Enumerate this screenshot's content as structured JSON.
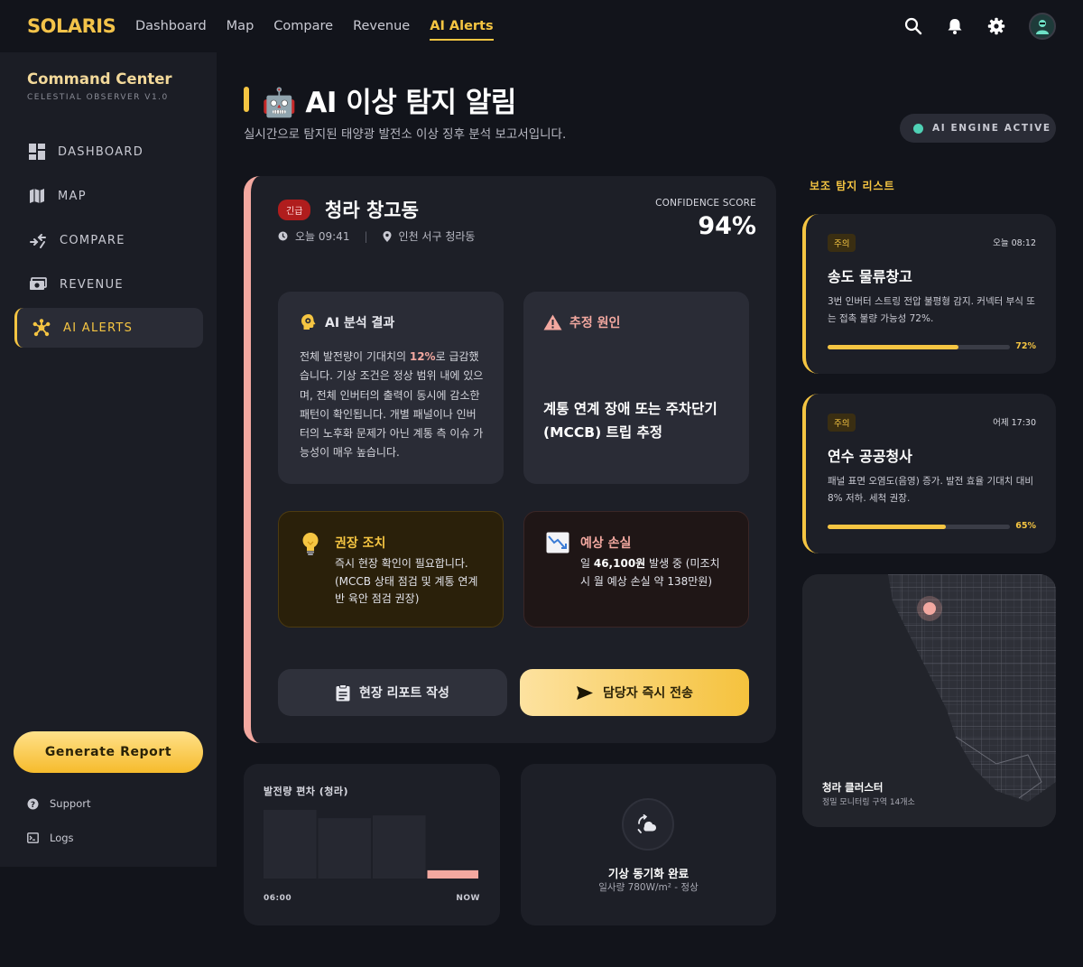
{
  "brand": "SOLARIS",
  "nav": [
    "Dashboard",
    "Map",
    "Compare",
    "Revenue",
    "AI Alerts"
  ],
  "top_icons": [
    "search-icon",
    "bell-icon",
    "gear-icon",
    "user-avatar"
  ],
  "sidebar": {
    "title": "Command Center",
    "subtitle": "CELESTIAL OBSERVER V1.0",
    "items": [
      {
        "label": "DASHBOARD",
        "icon": "dashboard-icon"
      },
      {
        "label": "MAP",
        "icon": "map-icon"
      },
      {
        "label": "COMPARE",
        "icon": "compare-icon"
      },
      {
        "label": "REVENUE",
        "icon": "money-icon"
      },
      {
        "label": "AI ALERTS",
        "icon": "hub-icon"
      }
    ],
    "generate_label": "Generate Report",
    "support_label": "Support",
    "logs_label": "Logs"
  },
  "header": {
    "title": "🤖 AI 이상 탐지 알림",
    "subtitle": "실시간으로 탐지된 태양광 발전소 이상 징후 분석 보고서입니다.",
    "engine_status": "AI ENGINE ACTIVE"
  },
  "main_alert": {
    "badge": "긴급",
    "site": "청라 창고동",
    "time": "오늘 09:41",
    "location": "인천 서구 청라동",
    "confidence_label": "CONFIDENCE SCORE",
    "confidence_value": "94%",
    "analysis_title": "AI 분석 결과",
    "analysis_pre": "전체 발전량이 기대치의 ",
    "analysis_highlight": "12%",
    "analysis_post": "로 급감했습니다. 기상 조건은 정상 범위 내에 있으며, 전체 인버터의 출력이 동시에 감소한 패턴이 확인됩니다. 개별 패널이나 인버터의 노후화 문제가 아닌 계통 측 이슈 가능성이 매우 높습니다.",
    "cause_title": "추정 원인",
    "cause_text": "계통 연계 장애 또는 주차단기(MCCB) 트립 추정",
    "action_title": "권장 조치",
    "action_text": "즉시 현장 확인이 필요합니다. (MCCB 상태 점검 및 계통 연계 반 육안 점검 권장)",
    "loss_title": "예상 손실",
    "loss_pre": "일 ",
    "loss_amount": "46,100원",
    "loss_post": " 발생 중 (미조치 시 월 예상 손실 약 138만원)",
    "report_button": "현장 리포트 작성",
    "send_button": "담당자 즉시 전송"
  },
  "deviation_chart": {
    "title": "발전량 편차 (청라)",
    "x_start": "06:00",
    "x_end": "NOW"
  },
  "chart_data": {
    "type": "bar",
    "title": "발전량 편차 (청라)",
    "categories": [
      "",
      "",
      "",
      ""
    ],
    "values": [
      100,
      88,
      92,
      12
    ],
    "colors": [
      "#262831",
      "#262831",
      "#262831",
      "#f3a8a0"
    ],
    "ylim": [
      0,
      100
    ],
    "xlabel": "",
    "ylabel": ""
  },
  "weather_sync": {
    "title": "기상 동기화 완료",
    "sub": "일사량 780W/m² - 정상"
  },
  "side_list": {
    "title": "보조 탐지 리스트",
    "items": [
      {
        "badge": "주의",
        "time": "오늘 08:12",
        "title": "송도 물류창고",
        "desc": "3번 인버터 스트링 전압 불평형 감지. 커넥터 부식 또는 접촉 불량 가능성 72%.",
        "progress": 0.72,
        "progress_label": "72%"
      },
      {
        "badge": "주의",
        "time": "어제 17:30",
        "title": "연수 공공청사",
        "desc": "패널 표면 오염도(음영) 증가. 발전 효율 기대치 대비 8% 저하. 세척 권장.",
        "progress": 0.65,
        "progress_label": "65%"
      }
    ]
  },
  "map_card": {
    "title": "청라 클러스터",
    "sub": "정밀 모니터링 구역 14개소"
  },
  "colors": {
    "accent": "#f5c542",
    "alert": "#f3a8a0",
    "urgent": "#b01d1d",
    "engine_dot": "#4fd1b5"
  }
}
